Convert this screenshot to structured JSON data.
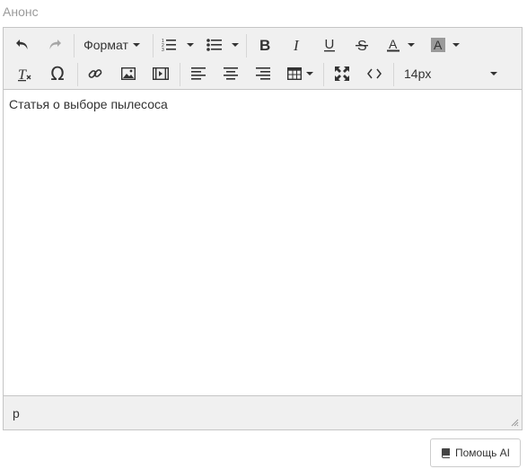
{
  "field": {
    "label": "Анонс"
  },
  "toolbar": {
    "format_label": "Формат",
    "font_size_label": "14px"
  },
  "content": {
    "text": "Статья о выборе пылесоса"
  },
  "statusbar": {
    "path": "p"
  },
  "ai_button": {
    "label": "Помощь AI"
  },
  "colors": {
    "toolbar_bg": "#f0f0f0",
    "border": "#c5c5c5",
    "icon": "#333333",
    "disabled_icon": "#a6a6a6",
    "label": "#9a9a9a"
  },
  "icons": [
    "undo-icon",
    "redo-icon",
    "numbered-list-icon",
    "bullet-list-icon",
    "bold-icon",
    "italic-icon",
    "underline-icon",
    "strikethrough-icon",
    "text-color-icon",
    "background-color-icon",
    "clear-formatting-icon",
    "special-char-icon",
    "link-icon",
    "image-icon",
    "media-icon",
    "align-left-icon",
    "align-center-icon",
    "align-right-icon",
    "table-icon",
    "fullscreen-icon",
    "source-code-icon",
    "resize-handle-icon",
    "book-icon"
  ]
}
